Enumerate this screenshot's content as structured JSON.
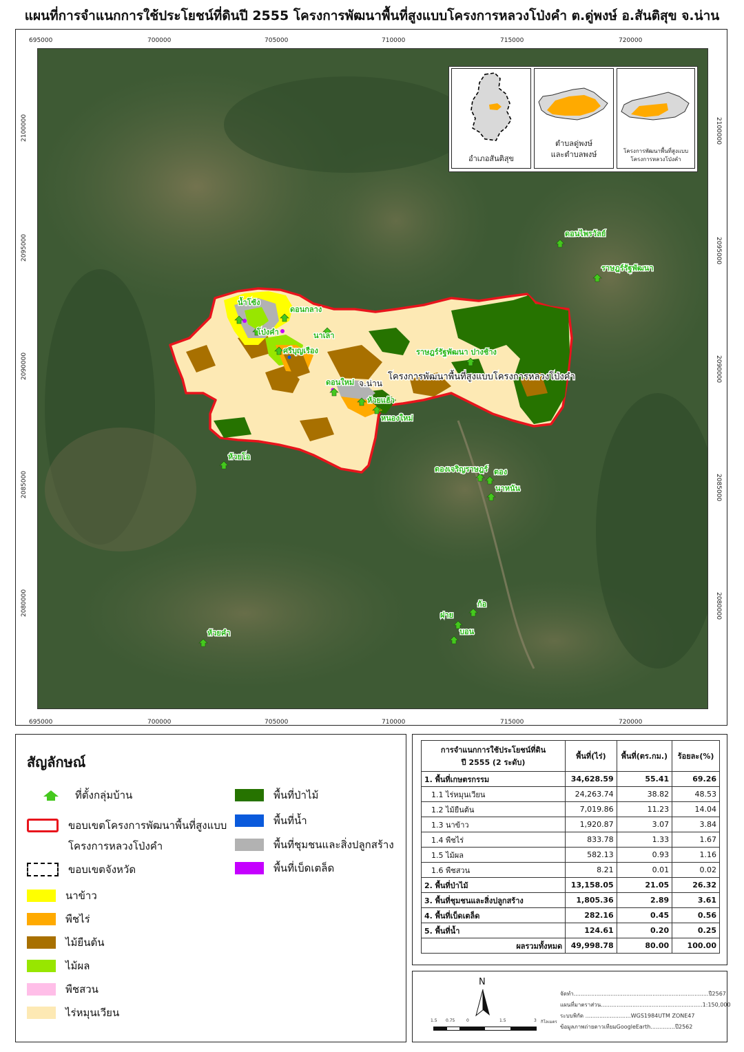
{
  "title": "แผนที่การจำแนกการใช้ประโยชน์ที่ดินปี 2555 โครงการพัฒนาพื้นที่สูงแบบโครงการหลวงโป่งคำ ต.ดู่พงษ์ อ.สันติสุข จ.น่าน",
  "axes": {
    "x_ticks": [
      "695000",
      "700000",
      "705000",
      "710000",
      "715000",
      "720000"
    ],
    "y_ticks": [
      "2100000",
      "2095000",
      "2090000",
      "2085000",
      "2080000"
    ]
  },
  "map": {
    "project_label": "โครงการพัฒนาพื้นที่สูงแบบโครงการหลวงโป่งคำ",
    "province_label": "จ.น่าน",
    "villages": [
      {
        "name": "น้ำโซ้ง"
      },
      {
        "name": "ดอนกลาง"
      },
      {
        "name": "โป่งคำ"
      },
      {
        "name": "นาเลา"
      },
      {
        "name": "ศรีบุญเรือง"
      },
      {
        "name": "ราษฎร์รัฐพัฒนา ปางช้าง"
      },
      {
        "name": "ดอนใหม่"
      },
      {
        "name": "ห้วยแฮ้ว"
      },
      {
        "name": "หนองใหม่"
      },
      {
        "name": "ดอนไพรวัลย์"
      },
      {
        "name": "ราษฎร์รัฐพัฒนา"
      },
      {
        "name": "ห้วยโอ"
      },
      {
        "name": "ตองเจริญราษฎร์"
      },
      {
        "name": "ตอง"
      },
      {
        "name": "นาหนัน"
      },
      {
        "name": "ก้อ"
      },
      {
        "name": "ฝาย"
      },
      {
        "name": "บอน"
      },
      {
        "name": "ห้วยคำ"
      }
    ]
  },
  "insets": [
    {
      "caption_lines": [
        "อำเภอสันติสุข"
      ]
    },
    {
      "caption_lines": [
        "ตำบลดู่พงษ์",
        "และตำบลพงษ์"
      ]
    },
    {
      "caption_lines": [
        "โครงการพัฒนาพื้นที่สูงแบบ",
        "โครงการหลวงโป่งคำ"
      ]
    }
  ],
  "legend": {
    "title": "สัญลักษณ์",
    "items": [
      {
        "label": "ที่ตั้งกลุ่มบ้าน",
        "kind": "village",
        "color": "#45c81e"
      },
      {
        "label": "ขอบเขตโครงการพัฒนาพื้นที่สูงแบบ",
        "label2": "โครงการหลวงโป่งคำ",
        "kind": "boundary",
        "color": "#e8141c"
      },
      {
        "label": "ขอบเขตจังหวัด",
        "kind": "province",
        "color": "#000000"
      },
      {
        "label": "นาข้าว",
        "kind": "fill",
        "color": "#ffff00"
      },
      {
        "label": "พืชไร่",
        "kind": "fill",
        "color": "#ffaa00"
      },
      {
        "label": "ไม้ยืนต้น",
        "kind": "fill",
        "color": "#a87000"
      },
      {
        "label": "ไม้ผล",
        "kind": "fill",
        "color": "#98e600"
      },
      {
        "label": "พืชสวน",
        "kind": "fill",
        "color": "#ffbee8"
      },
      {
        "label": "ไร่หมุนเวียน",
        "kind": "fill",
        "color": "#fde9b4"
      },
      {
        "label": "พื้นที่ป่าไม้",
        "kind": "fill",
        "color": "#267300"
      },
      {
        "label": "พื้นที่น้ำ",
        "kind": "fill",
        "color": "#0a5adc"
      },
      {
        "label": "พื้นที่ชุมชนและสิ่งปลูกสร้าง",
        "kind": "fill",
        "color": "#b2b2b2"
      },
      {
        "label": "พื้นที่เบ็ดเตล็ด",
        "kind": "fill",
        "color": "#c500ff"
      }
    ]
  },
  "table": {
    "header": {
      "col1_line1": "การจำแนกการใช้ประโยชน์ที่ดิน",
      "col1_line2": "ปี 2555 (2 ระดับ)",
      "col2": "พื้นที่(ไร่)",
      "col3": "พื้นที่(ตร.กม.)",
      "col4": "ร้อยละ(%)"
    },
    "rows": [
      {
        "label": "1. พื้นที่เกษตรกรรม",
        "rai": "34,628.59",
        "sqkm": "55.41",
        "pct": "69.26",
        "level": "major"
      },
      {
        "label": "1.1 ไร่หมุนเวียน",
        "rai": "24,263.74",
        "sqkm": "38.82",
        "pct": "48.53",
        "level": "sub"
      },
      {
        "label": "1.2 ไม้ยืนต้น",
        "rai": "7,019.86",
        "sqkm": "11.23",
        "pct": "14.04",
        "level": "sub"
      },
      {
        "label": "1.3 นาข้าว",
        "rai": "1,920.87",
        "sqkm": "3.07",
        "pct": "3.84",
        "level": "sub"
      },
      {
        "label": "1.4 พืชไร่",
        "rai": "833.78",
        "sqkm": "1.33",
        "pct": "1.67",
        "level": "sub"
      },
      {
        "label": "1.5 ไม้ผล",
        "rai": "582.13",
        "sqkm": "0.93",
        "pct": "1.16",
        "level": "sub"
      },
      {
        "label": "1.6 พืชสวน",
        "rai": "8.21",
        "sqkm": "0.01",
        "pct": "0.02",
        "level": "sub"
      },
      {
        "label": "2. พื้นที่ป่าไม้",
        "rai": "13,158.05",
        "sqkm": "21.05",
        "pct": "26.32",
        "level": "major"
      },
      {
        "label": "3. พื้นที่ชุมชนและสิ่งปลูกสร้าง",
        "rai": "1,805.36",
        "sqkm": "2.89",
        "pct": "3.61",
        "level": "major"
      },
      {
        "label": "4. พื้นที่เบ็ดเตล็ด",
        "rai": "282.16",
        "sqkm": "0.45",
        "pct": "0.56",
        "level": "major"
      },
      {
        "label": "5. พื้นที่น้ำ",
        "rai": "124.61",
        "sqkm": "0.20",
        "pct": "0.25",
        "level": "major"
      }
    ],
    "total": {
      "label": "ผลรวมทั้งหมด",
      "rai": "49,998.78",
      "sqkm": "80.00",
      "pct": "100.00"
    }
  },
  "info": {
    "north": "N",
    "lines": [
      "จัดทำ.............................................................................ปี2567",
      "แผนที่มาตราส่วน..........................................................1:150,000",
      "ระบบพิกัด ..........................WGS1984UTM ZONE47",
      "ข้อมูลภาพถ่ายดาวเทียมGoogleEarth..............ปี2562"
    ],
    "scale_labels": [
      "1.5",
      "0.75",
      "0",
      "1.5",
      "3"
    ],
    "scale_unit": "กิโลเมตร"
  }
}
